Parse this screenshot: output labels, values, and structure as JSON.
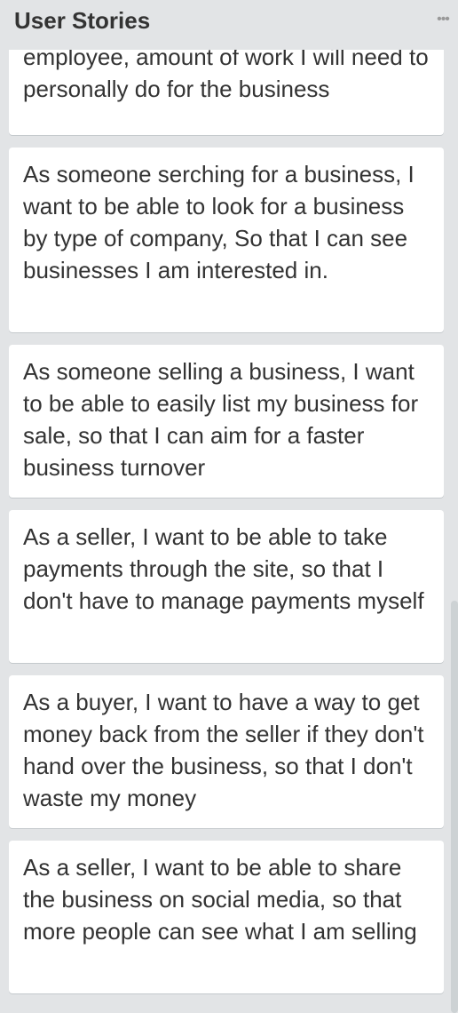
{
  "list": {
    "title": "User Stories",
    "menu_glyph": "•••"
  },
  "cards": [
    {
      "text": "employee, amount of work I will need to personally do for the business"
    },
    {
      "text": "As someone serching for a business, I want to be able to look for a business by type of company, So that I can see businesses I am interested in."
    },
    {
      "text": "As someone selling a business, I want to be able to easily list my business for sale, so that I can aim for a faster business turnover"
    },
    {
      "text": "As a seller, I want to be able to take payments through the site, so that I don't have to manage payments myself"
    },
    {
      "text": "As a buyer, I want to have a way to get money back from the seller if they don't hand over the business, so that I don't waste my money"
    },
    {
      "text": "As a seller, I want to be able to share the business on social media, so that more people can see what I am selling"
    }
  ]
}
